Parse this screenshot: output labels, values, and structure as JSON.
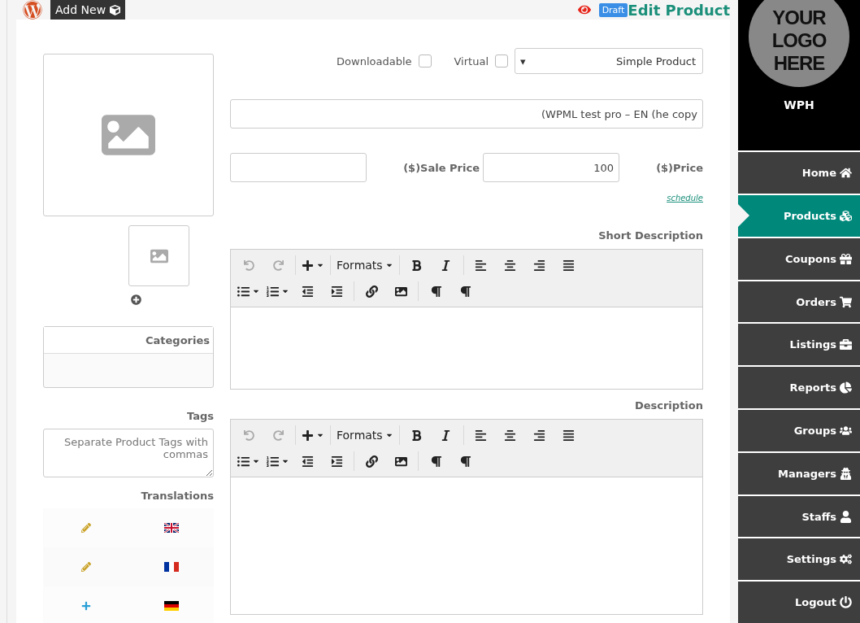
{
  "topbar": {
    "add_new": "Add New",
    "status_badge": "Draft",
    "title": "Edit Product"
  },
  "product": {
    "downloadable": {
      "label": "Downloadable",
      "checked": false
    },
    "virtual": {
      "label": "Virtual",
      "checked": false
    },
    "type_select": {
      "value": "Simple Product",
      "caret": "▾"
    },
    "name": "(WPML test pro – EN (he copy",
    "sale_price": {
      "label": "($)Sale Price"
    },
    "price": {
      "label": "($)Price",
      "value": "100"
    },
    "schedule_link": "schedule"
  },
  "editors": [
    {
      "label": "Short Description",
      "formats": "Formats",
      "history_disabled": true
    },
    {
      "label": "Description",
      "formats": "Formats",
      "history_disabled": true
    }
  ],
  "categories": {
    "title": "Categories"
  },
  "tags": {
    "label": "Tags",
    "placeholder": "Separate Product Tags with commas"
  },
  "translations": {
    "label": "Translations",
    "rows": [
      {
        "kind": "edit"
      },
      {
        "kind": "edit"
      },
      {
        "kind": "add"
      }
    ]
  },
  "sidebar": {
    "logo_text": "YOUR LOGO HERE",
    "site": "WPH",
    "items": [
      {
        "label": "Home",
        "selected": false
      },
      {
        "label": "Products",
        "selected": true
      },
      {
        "label": "Coupons",
        "selected": false
      },
      {
        "label": "Orders",
        "selected": false
      },
      {
        "label": "Listings",
        "selected": false
      },
      {
        "label": "Reports",
        "selected": false
      },
      {
        "label": "Groups",
        "selected": false
      },
      {
        "label": "Managers",
        "selected": false
      },
      {
        "label": "Staffs",
        "selected": false
      },
      {
        "label": "Settings",
        "selected": false
      },
      {
        "label": "Logout",
        "selected": false
      }
    ]
  }
}
